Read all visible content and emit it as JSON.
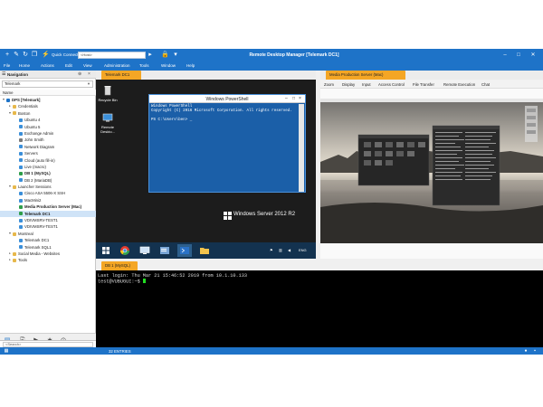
{
  "app": {
    "title": "Remote Desktop Manager [Telemark DC1]",
    "quick_connect_label": "Quick Connect",
    "quick_connect_placeholder": "<Host>"
  },
  "menu": [
    "File",
    "Home",
    "Actions",
    "Edit",
    "View",
    "Administration",
    "Tools",
    "Window",
    "Help"
  ],
  "navigation": {
    "title": "Navigation",
    "data_source": "Telemark",
    "column_header": "Name",
    "tree": [
      {
        "label": "DPS [Telemark]",
        "level": 0,
        "expander": "▼",
        "icon": "database-icon",
        "color": "#1e73c8",
        "bold": true
      },
      {
        "label": "Credentials",
        "level": 1,
        "expander": "▸",
        "icon": "folder-icon",
        "color": "#e7b84b"
      },
      {
        "label": "Boston",
        "level": 1,
        "expander": "▼",
        "icon": "folder-icon",
        "color": "#e7b84b"
      },
      {
        "label": "Ubuntu 4",
        "level": 2,
        "expander": "",
        "icon": "session-icon",
        "color": "#3b8fd9"
      },
      {
        "label": "Ubuntu 5",
        "level": 2,
        "expander": "",
        "icon": "session-icon",
        "color": "#3b8fd9"
      },
      {
        "label": "Exchange Admin",
        "level": 2,
        "expander": "",
        "icon": "session-icon",
        "color": "#3b8fd9"
      },
      {
        "label": "John Smith",
        "level": 2,
        "expander": "",
        "icon": "contact-icon",
        "color": "#7a7a7a"
      },
      {
        "label": "Network Diagram",
        "level": 2,
        "expander": "",
        "icon": "document-icon",
        "color": "#3b8fd9"
      },
      {
        "label": "Servers",
        "level": 2,
        "expander": "",
        "icon": "server-icon",
        "color": "#3b8fd9"
      },
      {
        "label": "Cloud (auto fill-in)",
        "level": 2,
        "expander": "",
        "icon": "cloud-icon",
        "color": "#3b8fd9"
      },
      {
        "label": "Live (macro)",
        "level": 2,
        "expander": "",
        "icon": "session-icon",
        "color": "#3b8fd9"
      },
      {
        "label": "DB 1 (MySQL)",
        "level": 2,
        "expander": "",
        "icon": "session-icon",
        "color": "#2e9e4a",
        "bold": true
      },
      {
        "label": "DB 2 (MariaDB)",
        "level": 2,
        "expander": "",
        "icon": "session-icon",
        "color": "#3b8fd9"
      },
      {
        "label": "Launcher Sessions",
        "level": 1,
        "expander": "▼",
        "icon": "folder-icon",
        "color": "#e7b84b"
      },
      {
        "label": "Cisco ASA 5506-X SSH",
        "level": 2,
        "expander": "",
        "icon": "session-icon",
        "color": "#3b8fd9"
      },
      {
        "label": "MacMini2",
        "level": 2,
        "expander": "",
        "icon": "session-icon",
        "color": "#3b8fd9"
      },
      {
        "label": "Media Production Server (Mac)",
        "level": 2,
        "expander": "",
        "icon": "session-icon",
        "color": "#2e9e4a",
        "bold": true
      },
      {
        "label": "Telemark DC1",
        "level": 2,
        "expander": "",
        "icon": "session-icon",
        "color": "#2e9e4a",
        "bold": true,
        "selected": true
      },
      {
        "label": "VDIVMSRV-TEST1",
        "level": 2,
        "expander": "",
        "icon": "session-icon",
        "color": "#3b8fd9"
      },
      {
        "label": "VDIVMSRV-TEST1",
        "level": 2,
        "expander": "",
        "icon": "session-icon",
        "color": "#3b8fd9"
      },
      {
        "label": "Montreal",
        "level": 1,
        "expander": "▼",
        "icon": "folder-icon",
        "color": "#e7b84b"
      },
      {
        "label": "Telemark DC1",
        "level": 2,
        "expander": "",
        "icon": "session-icon",
        "color": "#3b8fd9"
      },
      {
        "label": "Telemark SQL1",
        "level": 2,
        "expander": "",
        "icon": "session-icon",
        "color": "#3b8fd9"
      },
      {
        "label": "Social Media - Websites",
        "level": 1,
        "expander": "▸",
        "icon": "folder-icon",
        "color": "#e7b84b"
      },
      {
        "label": "Tools",
        "level": 1,
        "expander": "▸",
        "icon": "folder-icon",
        "color": "#e7b84b"
      }
    ]
  },
  "search": {
    "placeholder": "<Search>"
  },
  "status": {
    "entries": "32 ENTRIES"
  },
  "tabs": {
    "win": "Telemark DC1",
    "mac": "Media Production Server (Mac)",
    "term": "DB 1 (MySQL)"
  },
  "windows_session": {
    "desktop_icons": [
      "Recycle Bin",
      "Remote Deskto..."
    ],
    "ps_title": "Windows PowerShell",
    "ps_lines": "Windows PowerShell\nCopyright (C) 2016 Microsoft Corporation. All rights reserved.\n\nPS C:\\Users\\ben> _",
    "brand": "Windows Server 2012 R2",
    "tray_lang": "ENG"
  },
  "mac_session": {
    "toolbar": [
      "Zoom",
      "Display",
      "Input",
      "Access Control",
      "File Transfer",
      "Remote Execution",
      "Chat"
    ]
  },
  "terminal": {
    "line1": "Last login: Thu Mar 21 15:46:52 2019 from 10.1.10.133",
    "prompt": "test@VUBUGUI:~$ "
  },
  "colors": {
    "accent": "#1e73c8",
    "tab_active": "#f4a625",
    "selection": "#cfe3f7",
    "powershell": "#1b5fa8"
  }
}
